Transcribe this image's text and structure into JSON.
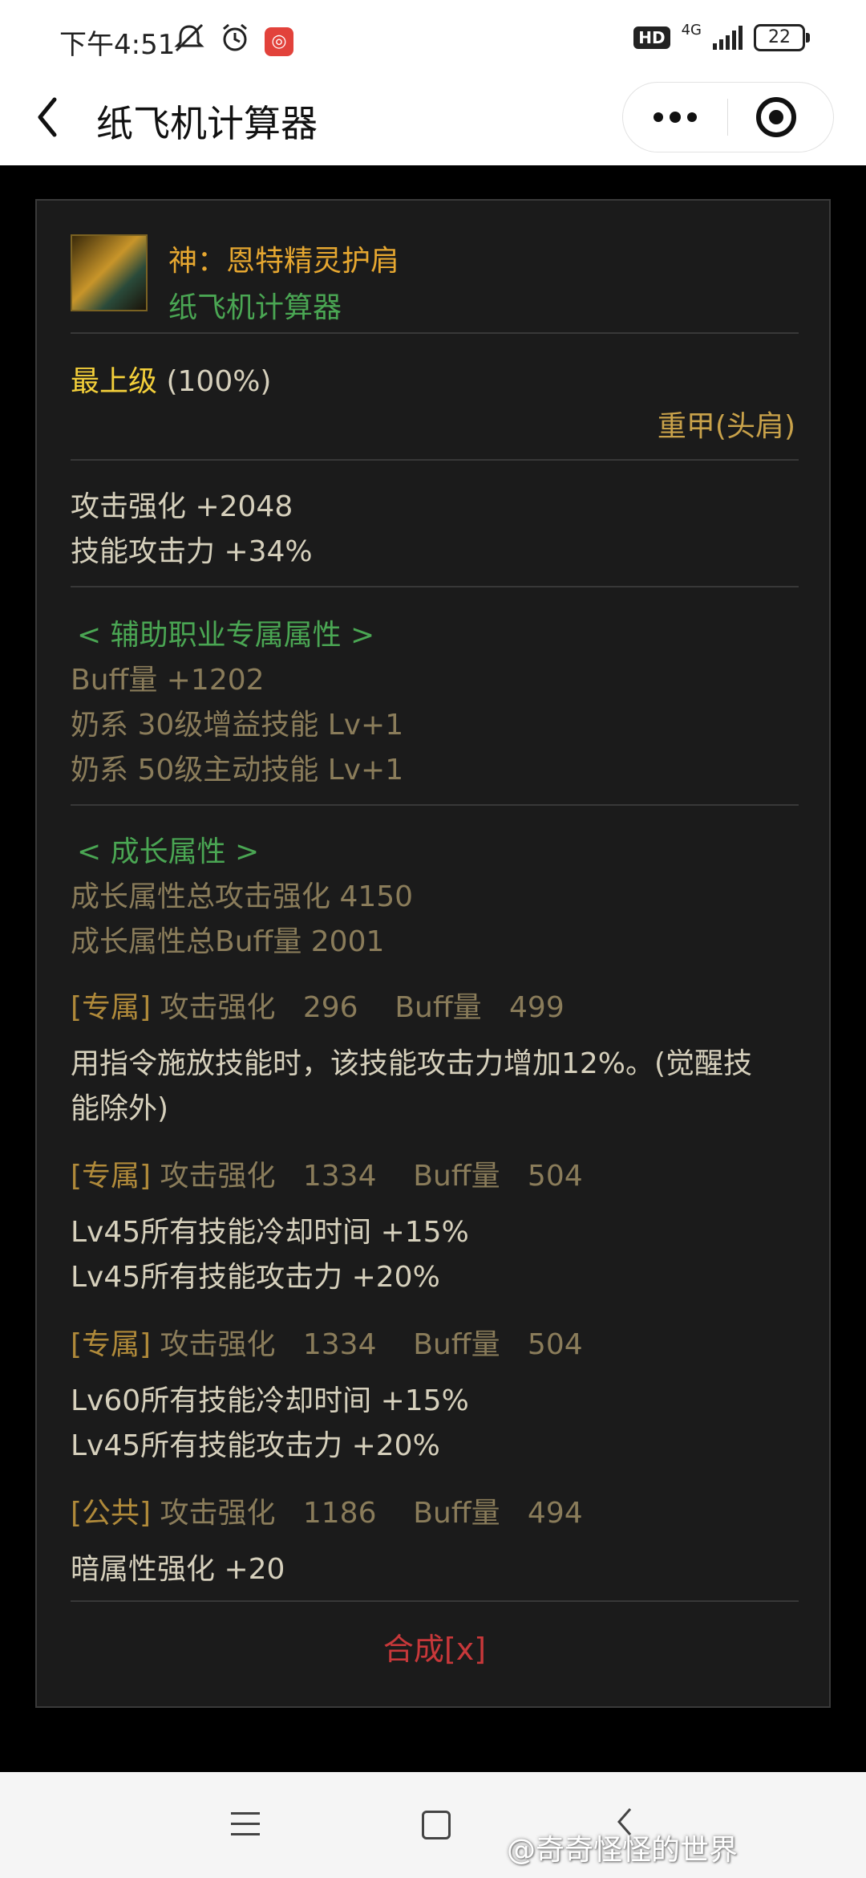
{
  "status_bar": {
    "time": "下午4:51",
    "network": "4G",
    "hd": "HD",
    "battery": "22"
  },
  "title_bar": {
    "title": "纸飞机计算器"
  },
  "item": {
    "name": "神：恩特精灵护肩",
    "source": "纸飞机计算器",
    "grade": "最上级",
    "grade_pct": "(100%)",
    "type": "重甲(头肩)",
    "base_stats": [
      "攻击强化 +2048",
      "技能攻击力 +34%"
    ],
    "support_header": "< 辅助职业专属属性 >",
    "support_stats": [
      "Buff量 +1202",
      "奶系 30级增益技能 Lv+1",
      "奶系 50级主动技能 Lv+1"
    ],
    "growth_header": "< 成长属性 >",
    "growth_totals": [
      "成长属性总攻击强化 4150",
      "成长属性总Buff量 2001"
    ],
    "growth_entries": [
      {
        "tag": "[专属]",
        "stat_line": "攻击强化   296    Buff量   499",
        "effects": [
          "用指令施放技能时，该技能攻击力增加12%。(觉醒技",
          "能除外)"
        ]
      },
      {
        "tag": "[专属]",
        "stat_line": "攻击强化   1334    Buff量   504",
        "effects": [
          "Lv45所有技能冷却时间 +15%",
          "Lv45所有技能攻击力 +20%"
        ]
      },
      {
        "tag": "[专属]",
        "stat_line": "攻击强化   1334    Buff量   504",
        "effects": [
          "Lv60所有技能冷却时间 +15%",
          "Lv45所有技能攻击力 +20%"
        ]
      },
      {
        "tag": "[公共]",
        "stat_line": "攻击强化   1186    Buff量   494",
        "effects": [
          "暗属性强化 +20"
        ]
      }
    ],
    "synth_label": "合成[x]"
  },
  "nav_bar": {
    "watermark": "@奇奇怪怪的世界"
  },
  "colors": {
    "card_bg": "#1b1b1b",
    "gold": "#f3cf3a",
    "green": "#4aa653",
    "red": "#c8383a"
  }
}
